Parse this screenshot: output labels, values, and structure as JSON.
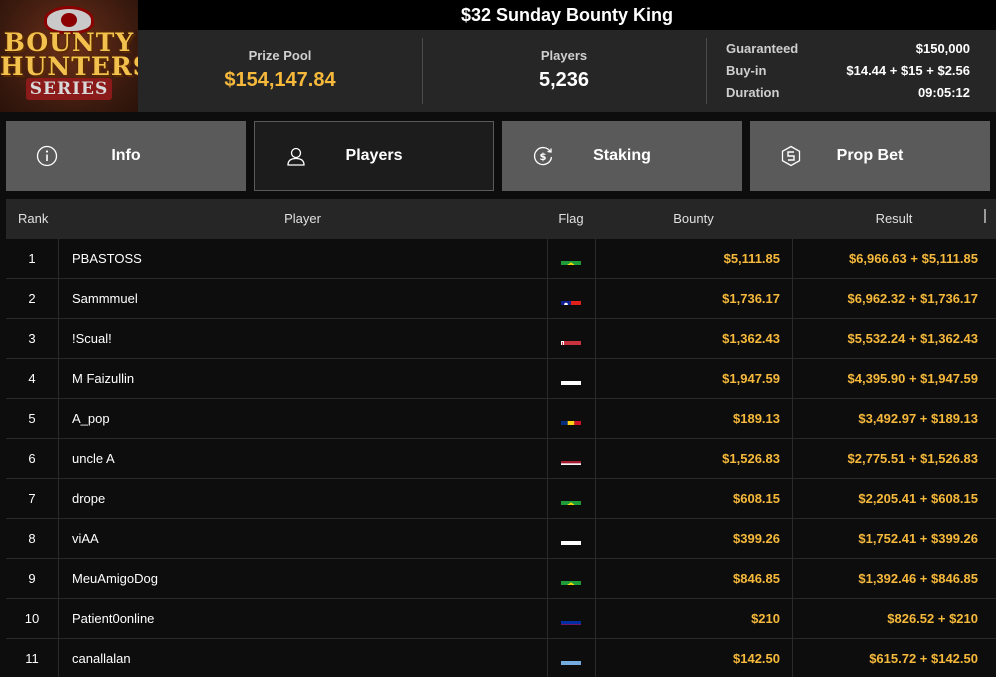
{
  "logo": {
    "line1": "BOUNTY",
    "line2": "HUNTERS",
    "line3": "SERIES"
  },
  "title": "$32 Sunday Bounty King",
  "stats": {
    "prize_pool_label": "Prize Pool",
    "prize_pool": "$154,147.84",
    "players_label": "Players",
    "players": "5,236",
    "guaranteed_label": "Guaranteed",
    "guaranteed": "$150,000",
    "buyin_label": "Buy-in",
    "buyin": "$14.44 + $15 + $2.56",
    "duration_label": "Duration",
    "duration": "09:05:12"
  },
  "tabs": [
    {
      "label": "Info",
      "icon": "info-icon",
      "active": false
    },
    {
      "label": "Players",
      "icon": "user-icon",
      "active": true
    },
    {
      "label": "Staking",
      "icon": "dollar-refresh-icon",
      "active": false
    },
    {
      "label": "Prop Bet",
      "icon": "prop-bet-icon",
      "active": false
    }
  ],
  "table": {
    "headers": {
      "rank": "Rank",
      "player": "Player",
      "flag": "Flag",
      "bounty": "Bounty",
      "result": "Result"
    },
    "rows": [
      {
        "rank": "1",
        "player": "PBASTOSS",
        "flag": "brazil",
        "bounty": "$5,111.85",
        "result": "$6,966.63 + $5,111.85"
      },
      {
        "rank": "2",
        "player": "Sammmuel",
        "flag": "taiwan",
        "bounty": "$1,736.17",
        "result": "$6,962.32 + $1,736.17"
      },
      {
        "rank": "3",
        "player": "!Scual!",
        "flag": "belarus",
        "bounty": "$1,362.43",
        "result": "$5,532.24 + $1,362.43"
      },
      {
        "rank": "4",
        "player": "M Faizullin",
        "flag": "russia",
        "bounty": "$1,947.59",
        "result": "$4,395.90 + $1,947.59"
      },
      {
        "rank": "5",
        "player": "A_pop",
        "flag": "romania",
        "bounty": "$189.13",
        "result": "$3,492.97 + $189.13"
      },
      {
        "rank": "6",
        "player": "uncle A",
        "flag": "thailand",
        "bounty": "$1,526.83",
        "result": "$2,775.51 + $1,526.83"
      },
      {
        "rank": "7",
        "player": "drope",
        "flag": "brazil",
        "bounty": "$608.15",
        "result": "$2,205.41 + $608.15"
      },
      {
        "rank": "8",
        "player": "viAA",
        "flag": "russia",
        "bounty": "$399.26",
        "result": "$1,752.41 + $399.26"
      },
      {
        "rank": "9",
        "player": "MeuAmigoDog",
        "flag": "brazil",
        "bounty": "$846.85",
        "result": "$1,392.46 + $846.85"
      },
      {
        "rank": "10",
        "player": "Patient0online",
        "flag": "cambodia",
        "bounty": "$210",
        "result": "$826.52 + $210"
      },
      {
        "rank": "11",
        "player": "canallalan",
        "flag": "argentina",
        "bounty": "$142.50",
        "result": "$615.72 + $142.50"
      }
    ]
  },
  "colors": {
    "accent": "#f6b93b",
    "tab_bg": "#5a5a5a",
    "header_bg": "#262626",
    "page_bg": "#0d0d0d"
  }
}
